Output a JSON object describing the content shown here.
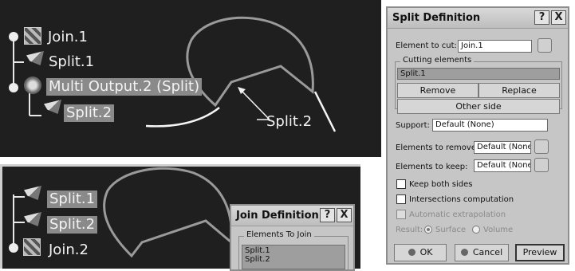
{
  "top_tree": {
    "join1": "Join.1",
    "split1": "Split.1",
    "multi_output": "Multi Output.2 (Split)",
    "split2": "Split.2"
  },
  "top_viewport": {
    "callout": "Split.2"
  },
  "bottom_tree": {
    "split1": "Split.1",
    "split2": "Split.2",
    "join2": "Join.2"
  },
  "split_dialog": {
    "title": "Split Definition",
    "help_button": "?",
    "close_button": "X",
    "element_to_cut_label": "Element to cut:",
    "element_to_cut_value": "Join.1",
    "cutting_elements_title": "Cutting elements",
    "cutting_elements_items": [
      "Split.1"
    ],
    "remove_label": "Remove",
    "replace_label": "Replace",
    "other_side_label": "Other side",
    "support_label": "Support:",
    "support_value": "Default (None)",
    "elements_to_remove_label": "Elements to remove:",
    "elements_to_remove_value": "Default (None)",
    "elements_to_keep_label": "Elements to keep:",
    "elements_to_keep_value": "Default (None)",
    "keep_both_sides_label": "Keep both sides",
    "intersections_label": "Intersections computation",
    "auto_extrapolation_label": "Automatic extrapolation",
    "result_label": "Result:",
    "surface_label": "Surface",
    "volume_label": "Volume",
    "ok_label": "OK",
    "cancel_label": "Cancel",
    "preview_label": "Preview"
  },
  "join_dialog": {
    "title": "Join Definition",
    "help_button": "?",
    "close_button": "X",
    "elements_to_join_title": "Elements To Join",
    "items": [
      "Split.1",
      "Split.2"
    ]
  },
  "colors": {
    "viewport_bg": "#1f1f1f",
    "dialog_bg": "#c6c6c6",
    "selection_gray": "#8a8a8a"
  }
}
